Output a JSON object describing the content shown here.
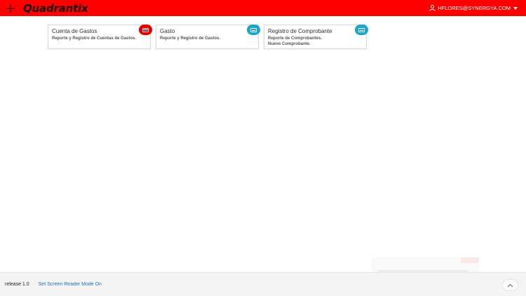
{
  "header": {
    "logo_text": "Quadrantix",
    "user_email": "HFLORES@SYNERGYA.COM",
    "brand_color": "#ff0000"
  },
  "cards": [
    {
      "title": "Cuenta de Gastos",
      "description": [
        "Reporte y Registro de Cuentas de Gastos."
      ],
      "icon": "credit-card-icon",
      "badge_color": "#e00000"
    },
    {
      "title": "Gasto",
      "description": [
        "Reporte y Registro de Gastos."
      ],
      "icon": "keyboard-icon",
      "badge_color": "#1aa8c6"
    },
    {
      "title": "Registro de Comprobante",
      "description": [
        "Reporte de Comprobantes.",
        "Nuevo Comprobante."
      ],
      "icon": "keyboard-icon",
      "badge_color": "#1aa8c6"
    }
  ],
  "footer": {
    "release": "release 1.0",
    "screen_reader_link": "Set Screen Reader Mode On"
  }
}
